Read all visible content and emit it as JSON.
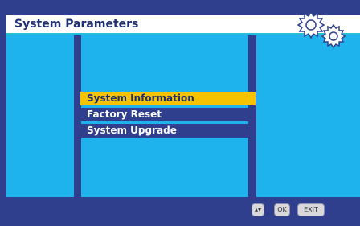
{
  "header": {
    "title": "System Parameters"
  },
  "menu": {
    "items": [
      {
        "label": "System Information",
        "selected": true
      },
      {
        "label": "Factory Reset",
        "selected": false
      },
      {
        "label": "System Upgrade",
        "selected": false
      }
    ]
  },
  "help": {
    "ok_label": "OK",
    "exit_label": "EXIT"
  },
  "colors": {
    "background": "#2f3f8e",
    "panel": "#1fb3ee",
    "accent": "#f7c300",
    "teal": "#22c0d8"
  }
}
